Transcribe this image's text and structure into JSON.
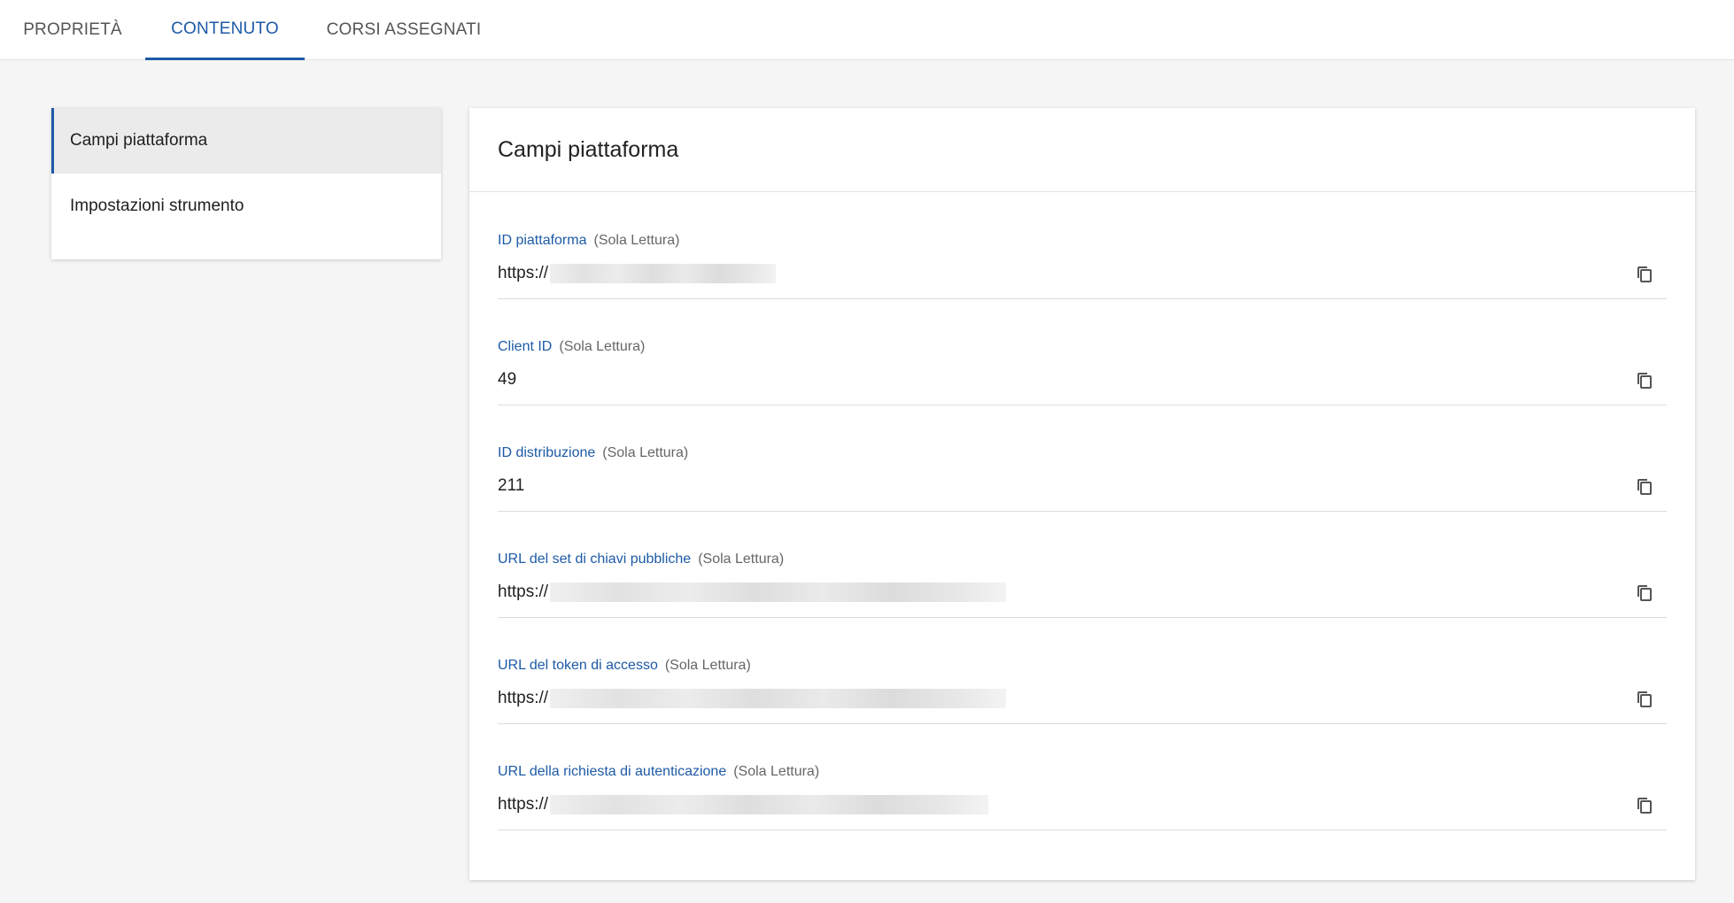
{
  "tabs": [
    {
      "label": "PROPRIETÀ"
    },
    {
      "label": "CONTENUTO"
    },
    {
      "label": "CORSI ASSEGNATI"
    }
  ],
  "sidebar": {
    "items": [
      {
        "label": "Campi piattaforma"
      },
      {
        "label": "Impostazioni strumento"
      }
    ]
  },
  "panel": {
    "title": "Campi piattaforma",
    "fields": [
      {
        "label": "ID piattaforma",
        "note": "(Sola Lettura)",
        "value": "https://"
      },
      {
        "label": "Client ID",
        "note": "(Sola Lettura)",
        "value": "49"
      },
      {
        "label": "ID distribuzione",
        "note": "(Sola Lettura)",
        "value": "211"
      },
      {
        "label": "URL del set di chiavi pubbliche",
        "note": "(Sola Lettura)",
        "value": "https://"
      },
      {
        "label": "URL del token di accesso",
        "note": "(Sola Lettura)",
        "value": "https://"
      },
      {
        "label": "URL della richiesta di autenticazione",
        "note": "(Sola Lettura)",
        "value": "https://"
      }
    ]
  },
  "icons": {
    "copy": "copy-icon"
  },
  "colors": {
    "accent": "#1d5aa6",
    "background": "#f5f5f5"
  }
}
